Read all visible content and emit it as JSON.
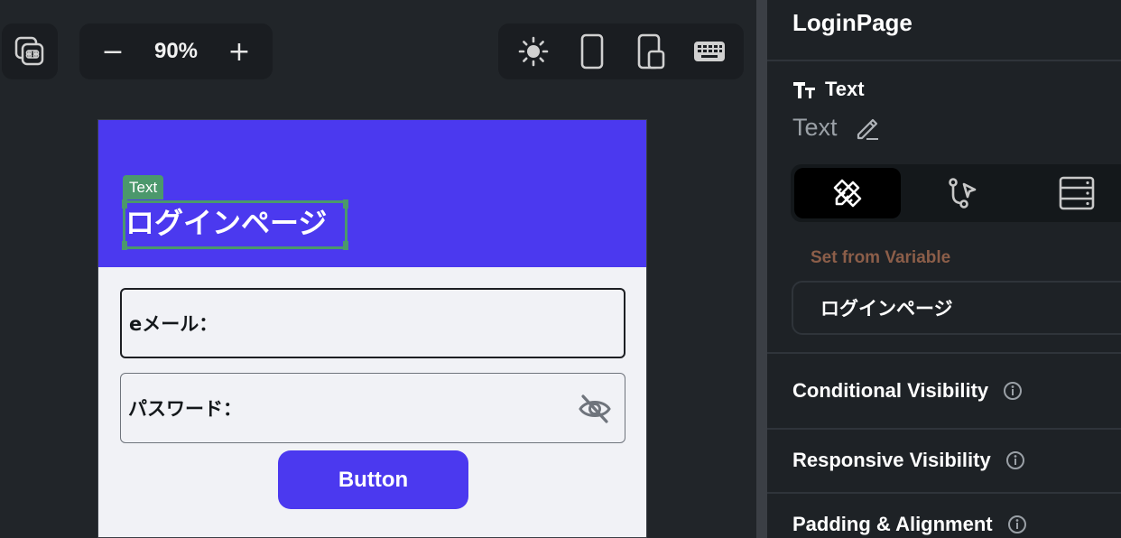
{
  "toolbar": {
    "zoom_value": "90%",
    "zoom_out_glyph": "−",
    "zoom_in_glyph": "+",
    "icons": [
      "command-icon",
      "sun-icon",
      "phone-icon",
      "tablet-icon",
      "keyboard-icon"
    ]
  },
  "preview": {
    "selected_tag": "Text",
    "appbar_title": "ログインページ",
    "email_label": "eメール：",
    "password_label": "パスワード：",
    "button_label": "Button",
    "colors": {
      "primary": "#4b39ef",
      "selection": "#4b986c",
      "background": "#f1f2f6"
    }
  },
  "panel": {
    "page_title": "LoginPage",
    "widget_type": "Text",
    "widget_name": "Text",
    "tabs": [
      "properties-tab",
      "actions-tab",
      "backend-query-tab"
    ],
    "variable_label": "Set from Variable",
    "variable_value": "ログインページ",
    "sections": [
      "Conditional Visibility",
      "Responsive Visibility",
      "Padding & Alignment"
    ]
  }
}
